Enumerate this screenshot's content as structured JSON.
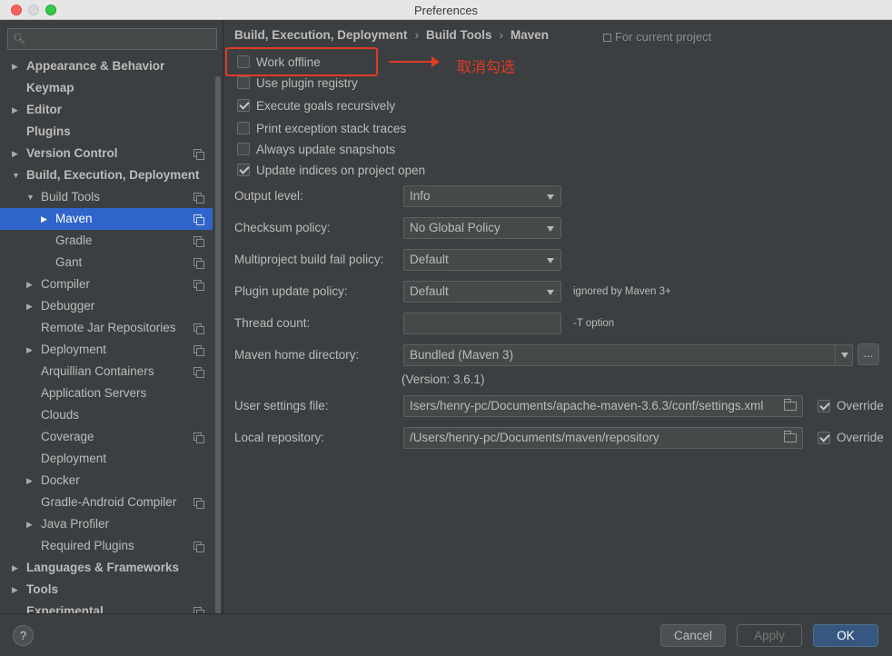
{
  "window": {
    "title": "Preferences"
  },
  "search": {
    "placeholder": ""
  },
  "sidebar": {
    "items": [
      {
        "label": "Appearance & Behavior",
        "bold": true,
        "arrow": "right"
      },
      {
        "label": "Keymap",
        "bold": true
      },
      {
        "label": "Editor",
        "bold": true,
        "arrow": "right"
      },
      {
        "label": "Plugins",
        "bold": true
      },
      {
        "label": "Version Control",
        "bold": true,
        "arrow": "right",
        "copy": true
      },
      {
        "label": "Build, Execution, Deployment",
        "bold": true,
        "arrow": "down"
      },
      {
        "label": "Build Tools",
        "arrow": "down",
        "copy": true
      },
      {
        "label": "Maven",
        "arrow": "right",
        "copy": true,
        "selected": true
      },
      {
        "label": "Gradle",
        "copy": true
      },
      {
        "label": "Gant",
        "copy": true
      },
      {
        "label": "Compiler",
        "arrow": "right",
        "copy": true
      },
      {
        "label": "Debugger",
        "arrow": "right"
      },
      {
        "label": "Remote Jar Repositories",
        "copy": true
      },
      {
        "label": "Deployment",
        "arrow": "right",
        "copy": true
      },
      {
        "label": "Arquillian Containers",
        "copy": true
      },
      {
        "label": "Application Servers"
      },
      {
        "label": "Clouds"
      },
      {
        "label": "Coverage",
        "copy": true
      },
      {
        "label": "Deployment"
      },
      {
        "label": "Docker",
        "arrow": "right"
      },
      {
        "label": "Gradle-Android Compiler",
        "copy": true
      },
      {
        "label": "Java Profiler",
        "arrow": "right"
      },
      {
        "label": "Required Plugins",
        "copy": true
      },
      {
        "label": "Languages & Frameworks",
        "bold": true,
        "arrow": "right"
      },
      {
        "label": "Tools",
        "bold": true,
        "arrow": "right"
      },
      {
        "label": "Experimental",
        "bold": true,
        "copy": true
      }
    ]
  },
  "breadcrumb": {
    "part1": "Build, Execution, Deployment",
    "part2": "Build Tools",
    "part3": "Maven",
    "separator": "›",
    "scope": "For current project"
  },
  "options": {
    "work_offline": {
      "label": "Work offline",
      "checked": false
    },
    "use_plugin_registry": {
      "label": "Use plugin registry",
      "checked": false
    },
    "execute_goals": {
      "label": "Execute goals recursively",
      "checked": true
    },
    "print_exception": {
      "label": "Print exception stack traces",
      "checked": false
    },
    "always_update": {
      "label": "Always update snapshots",
      "checked": false
    },
    "update_indices": {
      "label": "Update indices on project open",
      "checked": true
    }
  },
  "annotation": {
    "text": "取消勾选"
  },
  "fields": {
    "output_level": {
      "label": "Output level:",
      "value": "Info"
    },
    "checksum_policy": {
      "label": "Checksum policy:",
      "value": "No Global Policy"
    },
    "multiproject": {
      "label": "Multiproject build fail policy:",
      "value": "Default"
    },
    "plugin_update": {
      "label": "Plugin update policy:",
      "value": "Default",
      "hint": "ignored by Maven 3+"
    },
    "thread_count": {
      "label": "Thread count:",
      "value": "",
      "hint": "-T option"
    },
    "maven_home": {
      "label": "Maven home directory:",
      "value": "Bundled (Maven 3)",
      "button": "...",
      "version": "(Version: 3.6.1)"
    },
    "user_settings": {
      "label": "User settings file:",
      "value": "Isers/henry-pc/Documents/apache-maven-3.6.3/conf/settings.xml",
      "override_label": "Override",
      "override": true
    },
    "local_repo": {
      "label": "Local repository:",
      "value": "/Users/henry-pc/Documents/maven/repository",
      "override_label": "Override",
      "override": true
    }
  },
  "footer": {
    "help": "?",
    "cancel": "Cancel",
    "apply": "Apply",
    "ok": "OK"
  },
  "colors": {
    "accent": "#2f65ca",
    "ok_button": "#365880",
    "annotation": "#e03a24",
    "background": "#3c3f41"
  }
}
